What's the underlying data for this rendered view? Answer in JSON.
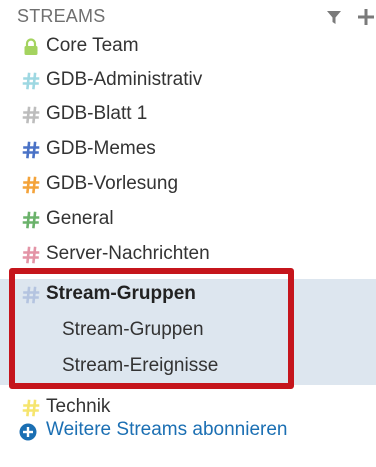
{
  "header": {
    "title": "STREAMS",
    "filter_icon": "filter-icon",
    "add_icon": "plus-icon"
  },
  "streams": [
    {
      "label": "Core Team",
      "icon": "lock-icon",
      "color": "#a4d35f"
    },
    {
      "label": "GDB-Administrativ",
      "icon": "hash-icon",
      "color": "#9ed8e2"
    },
    {
      "label": "GDB-Blatt 1",
      "icon": "hash-icon",
      "color": "#bdbdbd"
    },
    {
      "label": "GDB-Memes",
      "icon": "hash-icon",
      "color": "#4a72c6"
    },
    {
      "label": "GDB-Vorlesung",
      "icon": "hash-icon",
      "color": "#f4a33a"
    },
    {
      "label": "General",
      "icon": "hash-icon",
      "color": "#6bb26b"
    },
    {
      "label": "Server-Nachrichten",
      "icon": "hash-icon",
      "color": "#e394a6"
    },
    {
      "label": "Stream-Gruppen",
      "icon": "hash-icon",
      "color": "#b4c4e0",
      "active": true
    },
    {
      "label": "Technik",
      "icon": "hash-icon",
      "color": "#f6e56e"
    }
  ],
  "topics": [
    {
      "label": "Stream-Gruppen"
    },
    {
      "label": "Stream-Ereignisse"
    }
  ],
  "footer": {
    "label": "Weitere Streams abonnieren",
    "icon": "plus-circle-icon",
    "color": "#1b6fb3"
  },
  "highlight_color": "#c5151c"
}
